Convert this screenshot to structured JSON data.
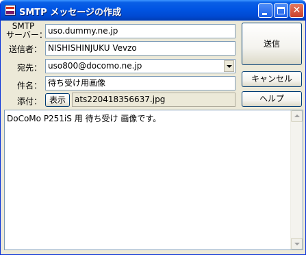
{
  "window": {
    "title": "SMTP メッセージの作成",
    "icon": "mail-app-icon",
    "controls": {
      "minimize": "minimize-icon",
      "maximize": "maximize-icon",
      "close": "✕"
    }
  },
  "form": {
    "smtp_label_line1": "SMTP",
    "smtp_label_line2": "サーバー：",
    "smtp_value": "uso.dummy.ne.jp",
    "sender_label": "送信者：",
    "sender_value": "NISHISHINJUKU Vevzo",
    "to_label": "宛先：",
    "to_value": "uso800@docomo.ne.jp",
    "subject_label": "件名：",
    "subject_value": "待ち受け用画像",
    "attach_label": "添付：",
    "attach_show_button": "表示",
    "attach_value": "ats220418356637.jpg"
  },
  "actions": {
    "send": "送信",
    "cancel": "キャンセル",
    "help": "ヘルプ"
  },
  "body": {
    "text": "DoCoMo P251iS 用 待ち受け 画像です。"
  },
  "colors": {
    "titlebar": "#0054e3",
    "window_bg": "#ece9d8",
    "field_border": "#7f9db9"
  }
}
